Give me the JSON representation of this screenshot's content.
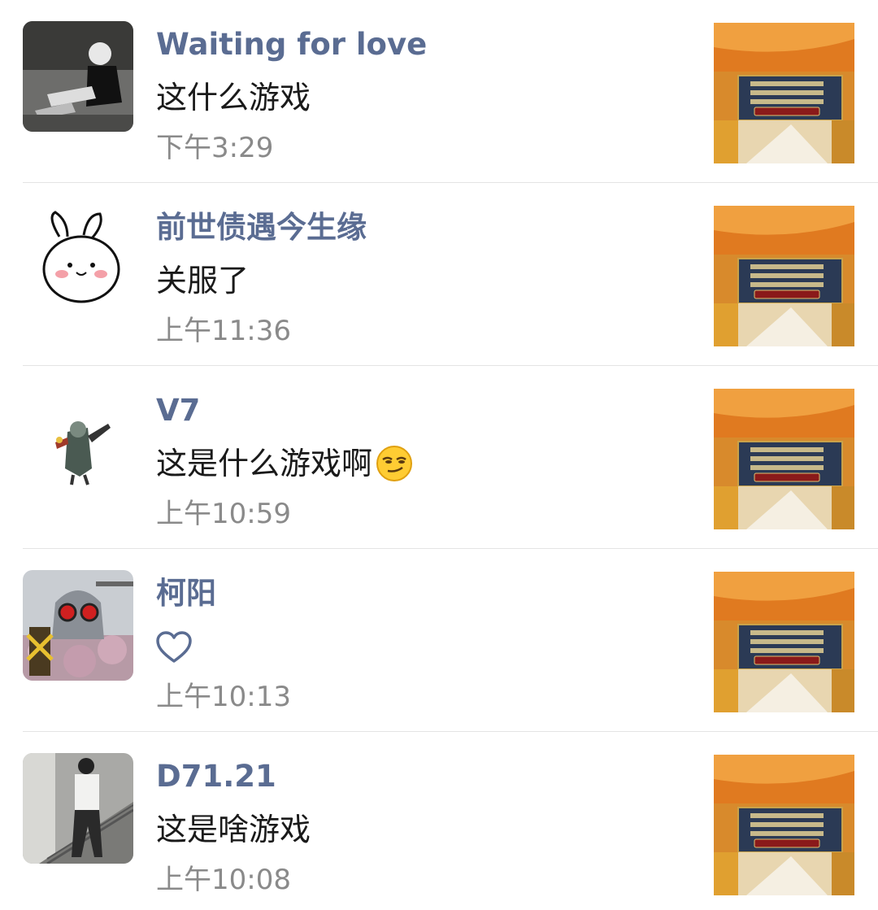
{
  "comments": [
    {
      "name": "Waiting for love",
      "text": "这什么游戏",
      "time": "下午3:29",
      "avatar_icon": "avatar-person-sitting-icon"
    },
    {
      "name": "前世债遇今生缘",
      "text": "关服了",
      "time": "上午11:36",
      "avatar_icon": "avatar-bunny-icon"
    },
    {
      "name": "V7",
      "text": "这是什么游戏啊",
      "emoji": "smirk-emoji",
      "time": "上午10:59",
      "avatar_icon": "avatar-warrior-icon"
    },
    {
      "name": "柯阳",
      "text": "",
      "like_icon": "heart-icon",
      "time": "上午10:13",
      "avatar_icon": "avatar-statue-icon"
    },
    {
      "name": "D71.21",
      "text": "这是啥游戏",
      "time": "上午10:08",
      "avatar_icon": "avatar-person-standing-icon"
    }
  ],
  "colors": {
    "name": "#5a6c92",
    "text": "#1a1a1a",
    "time": "#8a8a8a",
    "divider": "#e4e4e4"
  }
}
